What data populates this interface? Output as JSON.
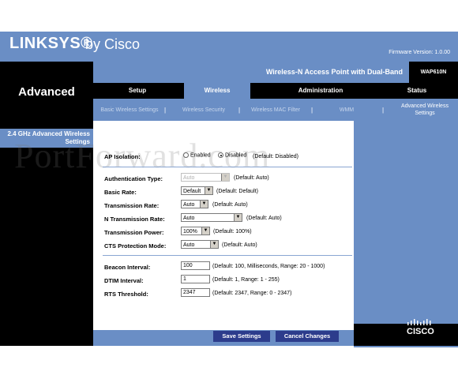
{
  "brand": {
    "logo_main": "LINKSYS®",
    "logo_sub": "by Cisco",
    "firmware": "Firmware Version: 1.0.00"
  },
  "product": {
    "name": "Wireless-N Access Point with Dual-Band",
    "model": "WAP610N"
  },
  "page": {
    "section_header": "Advanced",
    "sub_section": "2.4 GHz Advanced Wireless Settings"
  },
  "tabs": [
    {
      "label": "Setup"
    },
    {
      "label": "Wireless"
    },
    {
      "label": "Administration"
    },
    {
      "label": "Status"
    }
  ],
  "subnav": [
    {
      "label": "Basic Wireless Settings"
    },
    {
      "label": "Wireless Security"
    },
    {
      "label": "Wireless MAC Filter"
    },
    {
      "label": "WMM"
    },
    {
      "label": "Advanced Wireless Settings"
    }
  ],
  "subnav_separator": "|",
  "watermark": "PortForward.com",
  "form": {
    "ap_isolation": {
      "label": "AP Isolation:",
      "opt_enabled": "Enabled",
      "opt_disabled": "Disabled",
      "note": "(Default: Disabled)",
      "selected": "Disabled"
    },
    "auth_type": {
      "label": "Authentication Type:",
      "value": "Auto",
      "note": "(Default: Auto)"
    },
    "basic_rate": {
      "label": "Basic Rate:",
      "value": "Default",
      "note": "(Default: Default)"
    },
    "tx_rate": {
      "label": "Transmission Rate:",
      "value": "Auto",
      "note": "(Default: Auto)"
    },
    "n_tx_rate": {
      "label": "N Transmission Rate:",
      "value": "Auto",
      "note": "(Default: Auto)"
    },
    "tx_power": {
      "label": "Transmission Power:",
      "value": "100%",
      "note": "(Default: 100%)"
    },
    "cts": {
      "label": "CTS Protection Mode:",
      "value": "Auto",
      "note": "(Default: Auto)"
    },
    "beacon": {
      "label": "Beacon Interval:",
      "value": "100",
      "note": "(Default: 100, Milliseconds, Range: 20 - 1000)"
    },
    "dtim": {
      "label": "DTIM Interval:",
      "value": "1",
      "note": "(Default: 1, Range: 1 - 255)"
    },
    "rts": {
      "label": "RTS Threshold:",
      "value": "2347",
      "note": "(Default: 2347, Range: 0 - 2347)"
    }
  },
  "buttons": {
    "save": "Save Settings",
    "cancel": "Cancel Changes"
  },
  "footer_logo": {
    "word": "CISCO"
  },
  "colors": {
    "blue": "#6a8ec5",
    "black": "#000000",
    "button": "#2c3c8c"
  }
}
